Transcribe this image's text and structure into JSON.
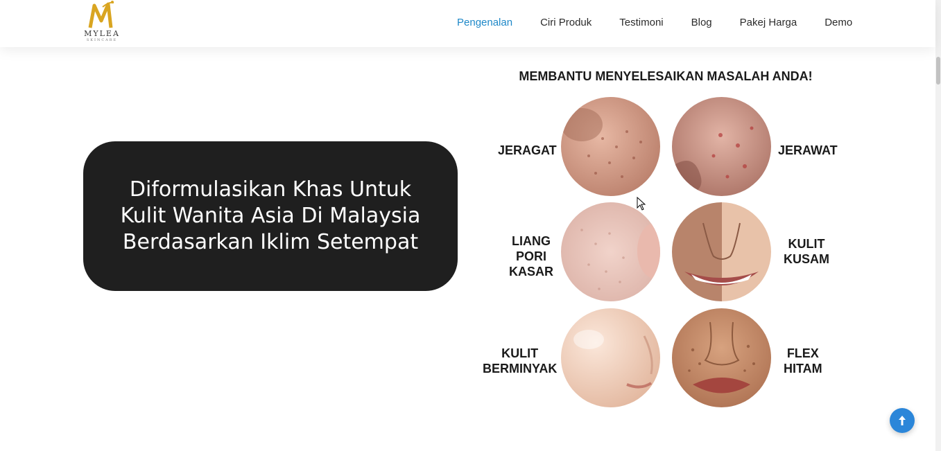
{
  "brand": {
    "name": "MYLEA",
    "tagline": "SKINCARE",
    "accent": "#d9a521"
  },
  "nav": {
    "items": [
      {
        "label": "Pengenalan",
        "active": true
      },
      {
        "label": "Ciri Produk",
        "active": false
      },
      {
        "label": "Testimoni",
        "active": false
      },
      {
        "label": "Blog",
        "active": false
      },
      {
        "label": "Pakej Harga",
        "active": false
      },
      {
        "label": "Demo",
        "active": false
      }
    ],
    "active_color": "#1e88c8"
  },
  "hero": {
    "heading": "Diformulasikan Khas Untuk Kulit Wanita Asia Di Malaysia Berdasarkan Iklim Setempat",
    "card_color": "#1f1f1f"
  },
  "figure": {
    "title": "MEMBANTU MENYELESAIKAN MASALAH ANDA!",
    "labels": {
      "jeragat": "JERAGAT",
      "jerawat": "JERAWAT",
      "liang_pori_kasar": [
        "LIANG",
        "PORI",
        "KASAR"
      ],
      "kulit_kusam": [
        "KULIT",
        "KUSAM"
      ],
      "kulit_berminyak": [
        "KULIT",
        "BERMINYAK"
      ],
      "flex_hitam": [
        "FLEX",
        "HITAM"
      ]
    }
  },
  "back_to_top": {
    "icon": "arrow-up-icon",
    "color": "#2b86d9"
  }
}
